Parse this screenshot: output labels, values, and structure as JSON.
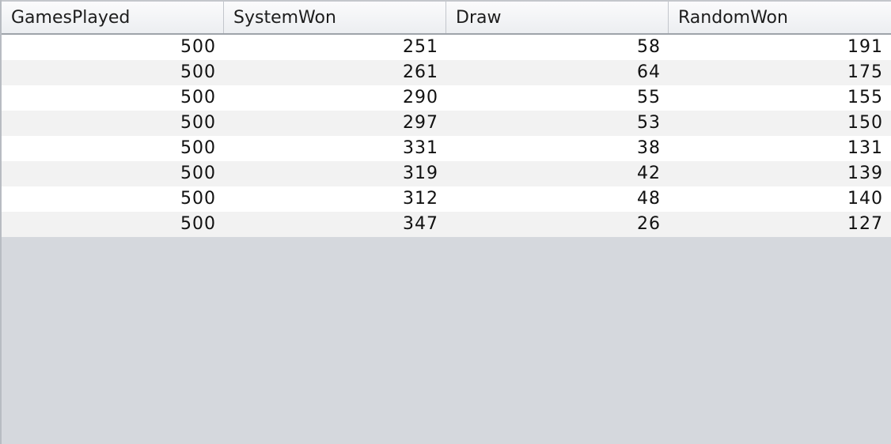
{
  "table": {
    "columns": [
      "GamesPlayed",
      "SystemWon",
      "Draw",
      "RandomWon"
    ],
    "rows": [
      [
        "500",
        "251",
        "58",
        "191"
      ],
      [
        "500",
        "261",
        "64",
        "175"
      ],
      [
        "500",
        "290",
        "55",
        "155"
      ],
      [
        "500",
        "297",
        "53",
        "150"
      ],
      [
        "500",
        "331",
        "38",
        "131"
      ],
      [
        "500",
        "319",
        "42",
        "139"
      ],
      [
        "500",
        "312",
        "48",
        "140"
      ],
      [
        "500",
        "347",
        "26",
        "127"
      ]
    ]
  },
  "colors": {
    "row_odd": "#ffffff",
    "row_even": "#f2f2f2",
    "empty_area": "#d5d8dd"
  }
}
